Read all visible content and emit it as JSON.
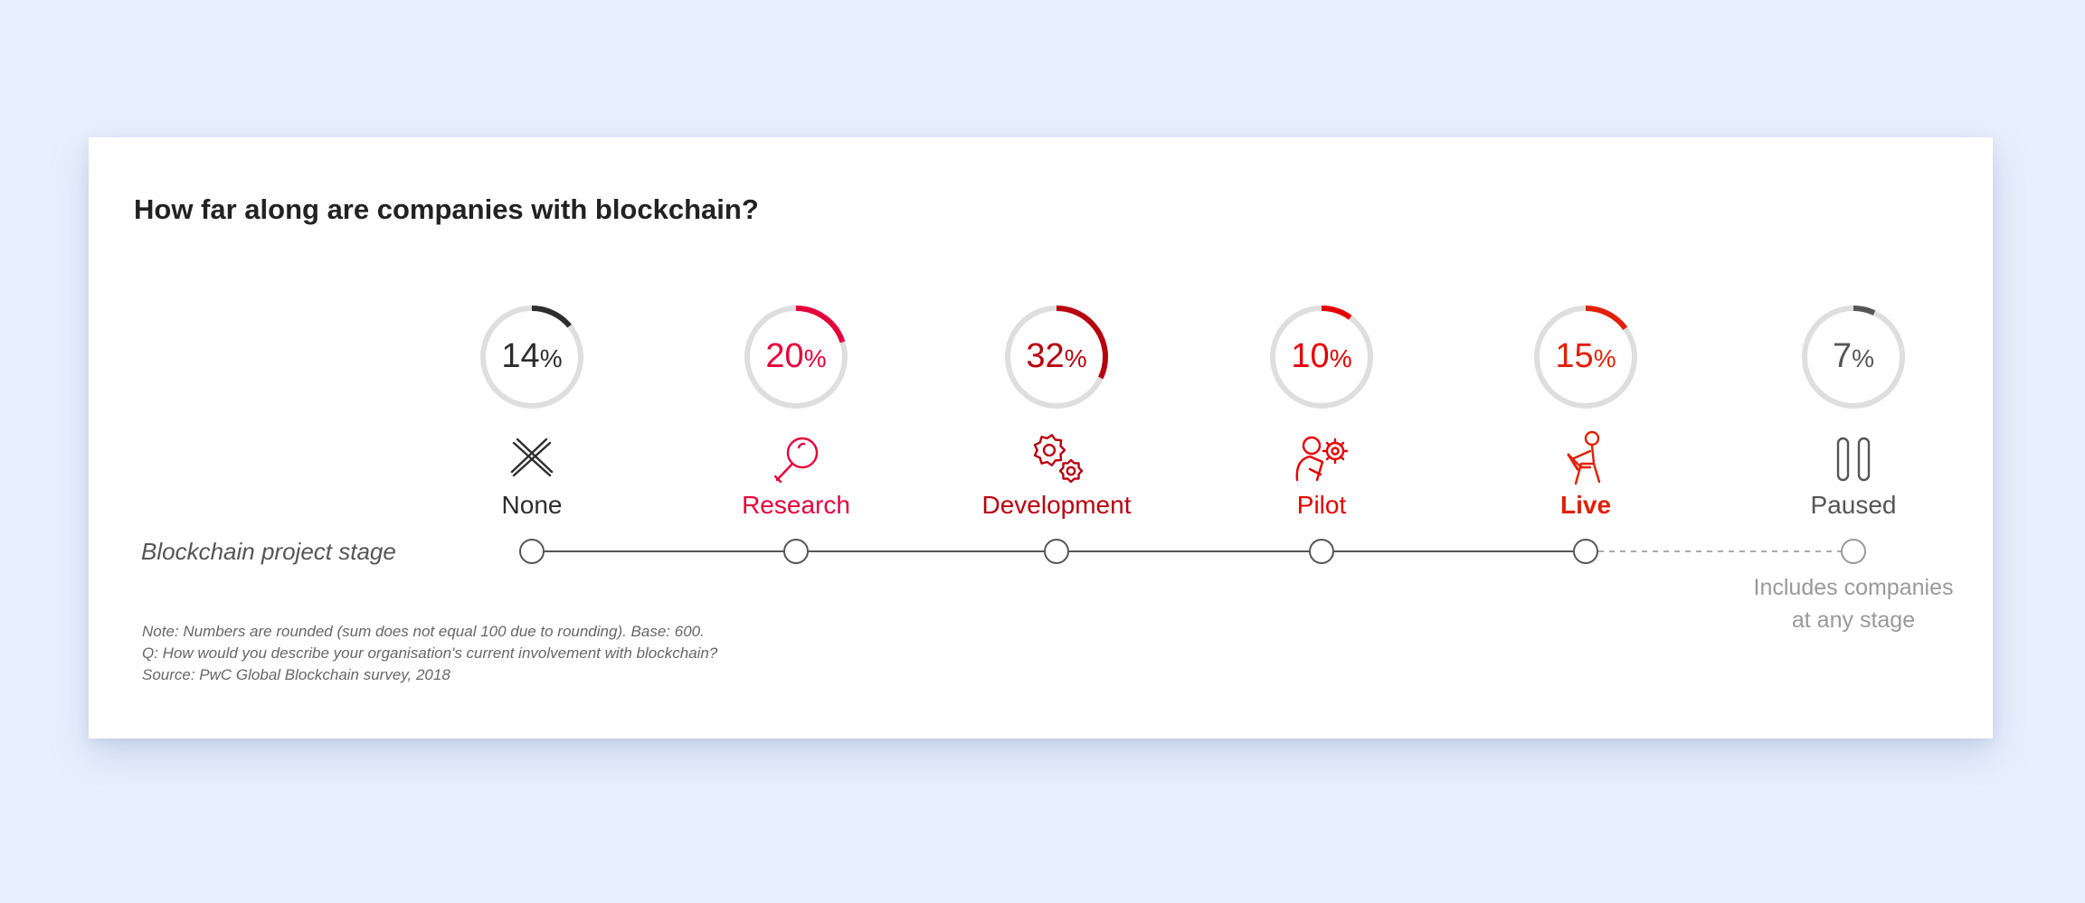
{
  "title": "How far along are companies with blockchain?",
  "axis_label": "Blockchain project stage",
  "notes": [
    "Note: Numbers are rounded (sum does not equal 100 due to rounding). Base: 600.",
    "Q: How would you describe your organisation's current involvement with blockchain?",
    "Source: PwC Global Blockchain survey, 2018"
  ],
  "colors": {
    "background": "#e8f0fd",
    "ring_track": "#dedede",
    "line": "#555555",
    "dashed_line": "#aaaaaa"
  },
  "chart_data": {
    "type": "progress-rings",
    "title": "How far along are companies with blockchain?",
    "xlabel": "Blockchain project stage",
    "unit": "%",
    "categories": [
      "None",
      "Research",
      "Development",
      "Pilot",
      "Live",
      "Paused"
    ],
    "values": [
      14,
      20,
      32,
      10,
      15,
      7
    ],
    "colors": [
      "#2d2d2d",
      "#e4003b",
      "#b8000f",
      "#e60000",
      "#e21f05",
      "#555555"
    ],
    "stages": [
      {
        "label": "None",
        "value": 14,
        "value_text": "14",
        "icon": "x-icon",
        "color": "#2d2d2d",
        "arc": "#2d2d2d",
        "bold": false
      },
      {
        "label": "Research",
        "value": 20,
        "value_text": "20",
        "icon": "magnifier-icon",
        "color": "#e4003b",
        "arc": "#e4003b",
        "bold": false
      },
      {
        "label": "Development",
        "value": 32,
        "value_text": "32",
        "icon": "gears-icon",
        "color": "#b8000f",
        "arc": "#b8000f",
        "bold": false
      },
      {
        "label": "Pilot",
        "value": 10,
        "value_text": "10",
        "icon": "person-gear-icon",
        "color": "#e60000",
        "arc": "#e60000",
        "bold": false
      },
      {
        "label": "Live",
        "value": 15,
        "value_text": "15",
        "icon": "person-laptop-icon",
        "color": "#e21f05",
        "arc": "#e21f05",
        "bold": true
      },
      {
        "label": "Paused",
        "value": 7,
        "value_text": "7",
        "icon": "pause-icon",
        "color": "#555555",
        "arc": "#555555",
        "bold": false,
        "sub": [
          "Includes companies",
          "at any stage"
        ]
      }
    ],
    "value_range": [
      0,
      100
    ]
  }
}
